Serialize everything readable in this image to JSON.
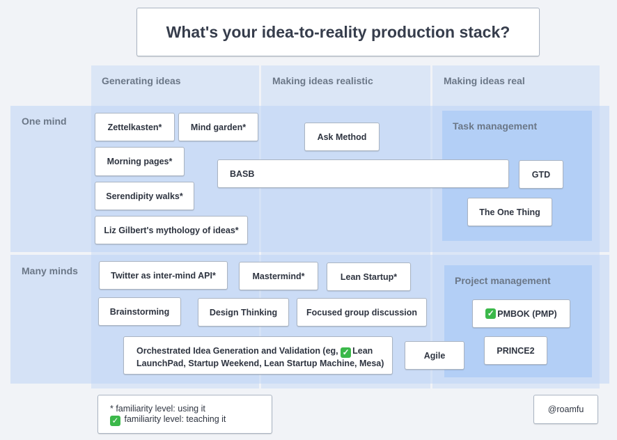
{
  "title": "What's your idea-to-reality production stack?",
  "columns": [
    "Generating ideas",
    "Making ideas realistic",
    "Making ideas real"
  ],
  "rows": [
    "One mind",
    "Many minds"
  ],
  "subgroups": {
    "task": "Task management",
    "project": "Project management"
  },
  "cards": {
    "zettelkasten": "Zettelkasten*",
    "mind_garden": "Mind garden*",
    "morning_pages": "Morning pages*",
    "serendipity": "Serendipity walks*",
    "liz": "Liz Gilbert's mythology of ideas*",
    "ask_method": "Ask Method",
    "basb": "BASB",
    "gtd": "GTD",
    "one_thing": "The One Thing",
    "twitter": "Twitter as inter-mind API*",
    "mastermind": "Mastermind*",
    "lean_startup": "Lean Startup*",
    "brainstorming": "Brainstorming",
    "design_thinking": "Design Thinking",
    "focused_group": "Focused group discussion",
    "orchestrated_1": "Orchestrated Idea Generation and Validation (eg,",
    "orchestrated_1b": "Lean",
    "orchestrated_2": "LaunchPad, Startup Weekend, Lean Startup Machine, Mesa)",
    "agile": "Agile",
    "pmbok": "PMBOK (PMP)",
    "prince2": "PRINCE2"
  },
  "legend": {
    "line1": "* familiarity level: using it",
    "line2": "familiarity level: teaching it"
  },
  "check_glyph": "✓",
  "author": "@roamfu"
}
